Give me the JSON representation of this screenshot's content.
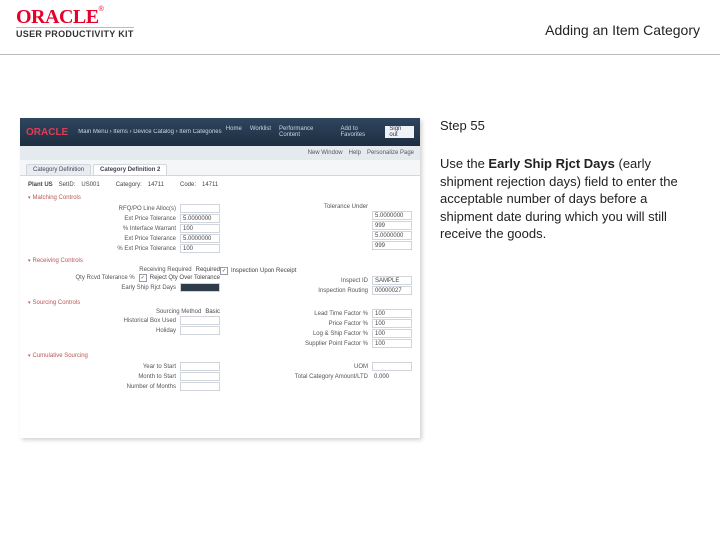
{
  "header": {
    "logo_brand": "ORACLE",
    "logo_tm": "®",
    "logo_sub": "USER PRODUCTIVITY KIT",
    "title": "Adding an Item Category"
  },
  "rhs": {
    "step": "Step 55",
    "para_pre": "Use the ",
    "para_bold": "Early Ship Rjct Days",
    "para_post": " (early shipment rejection days) field to enter the acceptable number of days before a shipment date during which you will still receive the goods."
  },
  "shot": {
    "brand": "ORACLE",
    "breadcrumb": "Main Menu  ›  Items  ›  Device Catalog  ›  Item Categories…",
    "toptabs": [
      "Home",
      "Worklist",
      "Performance Content",
      "Add to Favorites",
      "Sign out"
    ],
    "subnav": [
      "New Window",
      "Help",
      "Personalize Page"
    ],
    "pagetabs": [
      "Category Definition",
      "Category Definition 2"
    ],
    "setid_line": {
      "plant": "Plant US",
      "setid": "SetID:",
      "setid_v": "US001",
      "category_lbl": "Category:",
      "category_v": "14711",
      "code_lbl": "Code:",
      "code_v": "14711"
    },
    "sections": {
      "matching": "Matching Controls",
      "receiving": "Receiving Controls",
      "sourcing": "Sourcing Controls",
      "cumulative": "Cumulative Sourcing"
    },
    "matching": {
      "left": [
        {
          "l": "RFQ/PO Line Alloc(s)",
          "v": ""
        },
        {
          "l": "Ext Price Tolerance",
          "v": "5.0000000"
        },
        {
          "l": "% Interface Warrant",
          "v": "100"
        },
        {
          "l": "Ext Price Tolerance",
          "v": "5.0000000"
        },
        {
          "l": "% Ext Price Tolerance",
          "v": "100"
        }
      ],
      "right_hdr": "Tolerance Under",
      "right": [
        "5.0000000",
        "999",
        "5.0000000",
        "999"
      ]
    },
    "receiving": {
      "left": [
        {
          "l": "Receiving Required",
          "sel": "Required"
        },
        {
          "l": "Qty Rcvd Tolerance %",
          "txt": "Reject Qty Over Tolerance"
        }
      ],
      "right": [
        {
          "l": "Inspection Upon Receipt",
          "chk": true
        },
        {
          "l": "Inspect ID",
          "v": "SAMPLE"
        },
        {
          "l": "Inspection Routing",
          "v": "00000027"
        }
      ],
      "ship_label": "Early Ship Rjct Days"
    },
    "sourcing": {
      "left": [
        {
          "l": "Sourcing Method",
          "sel": "Basic"
        },
        {
          "l": "Historical Box Used",
          "v": ""
        },
        {
          "l": "Holiday",
          "v": ""
        }
      ],
      "right": [
        {
          "l": "Lead Time Factor %",
          "v": "100"
        },
        {
          "l": "Price Factor %",
          "v": "100"
        },
        {
          "l": "Log & Ship Factor %",
          "v": "100"
        },
        {
          "l": "Supplier Point Factor %",
          "v": "100"
        }
      ]
    },
    "cumulative": {
      "left": [
        {
          "l": "Year to Start",
          "v": ""
        },
        {
          "l": "Month to Start",
          "v": ""
        },
        {
          "l": "Number of Months",
          "v": ""
        }
      ],
      "right": [
        {
          "l": "UOM",
          "v": ""
        },
        {
          "l": "Total Category Amount/LTD",
          "v": "0.000"
        }
      ]
    }
  }
}
